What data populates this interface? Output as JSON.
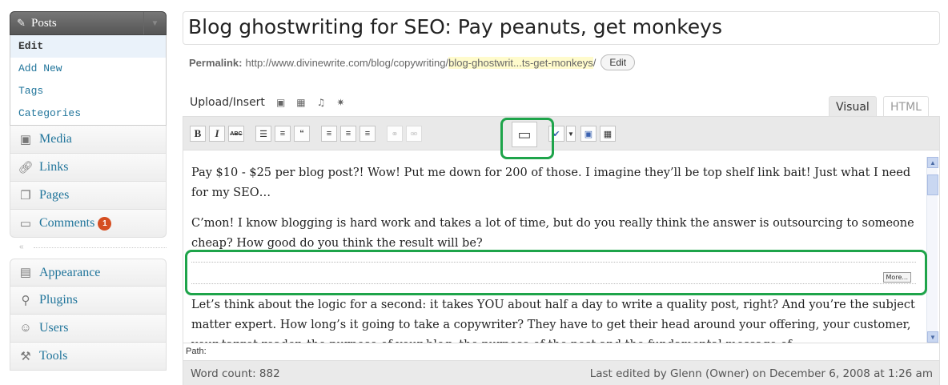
{
  "sidebar": {
    "posts_label": "Posts",
    "posts_icon": "pushpin-icon",
    "submenu": [
      "Edit",
      "Add New",
      "Tags",
      "Categories"
    ],
    "items_group1": [
      {
        "label": "Media",
        "icon": "media-icon"
      },
      {
        "label": "Links",
        "icon": "links-icon"
      },
      {
        "label": "Pages",
        "icon": "pages-icon"
      },
      {
        "label": "Comments",
        "icon": "comments-icon",
        "badge": "1"
      }
    ],
    "items_group2": [
      {
        "label": "Appearance",
        "icon": "appearance-icon"
      },
      {
        "label": "Plugins",
        "icon": "plugins-icon"
      },
      {
        "label": "Users",
        "icon": "users-icon"
      },
      {
        "label": "Tools",
        "icon": "tools-icon"
      }
    ]
  },
  "post": {
    "title": "Blog ghostwriting for SEO: Pay peanuts, get monkeys",
    "permalink_label": "Permalink:",
    "permalink_base": "http://www.divinewrite.com/blog/copywriting/",
    "permalink_slug": "blog-ghostwrit...ts-get-monkeys",
    "permalink_trail": "/",
    "permalink_edit": "Edit"
  },
  "editor": {
    "upload_label": "Upload/Insert",
    "tab_visual": "Visual",
    "tab_html": "HTML",
    "toolbar": {
      "bold": "B",
      "italic": "I",
      "strike": "ABC"
    },
    "paragraph1": "Pay $10 - $25 per blog post?! Wow! Put me down for 200 of those. I imagine they’ll be top shelf link bait! Just what I need for my SEO…",
    "paragraph2": "C’mon! I know blogging is hard work and takes a lot of time, but do you really think the answer is outsourcing to someone cheap? How good do you think the result will be?",
    "more_tag": "More...",
    "paragraph3": "Let’s think about the logic for a second: it takes YOU about half a day to write a quality post, right? And you’re the subject matter expert. How long’s it going to take a copywriter? They have to get their head around your offering, your customer, your target reader, the purpose of your blog, the purpose of the post and the fundamental message of",
    "path_label": "Path:",
    "word_count": "Word count: 882",
    "last_edited": "Last edited by Glenn (Owner) on December 6, 2008 at 1:26 am"
  },
  "colors": {
    "highlight": "#1ea44a",
    "link": "#21759b",
    "badge": "#d54e21"
  }
}
